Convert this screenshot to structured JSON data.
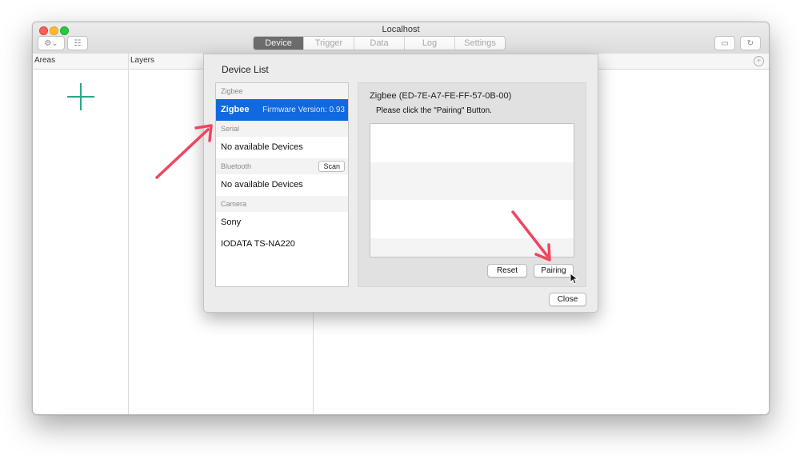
{
  "window": {
    "title": "Localhost"
  },
  "toolbar": {
    "tabs": [
      "Device",
      "Trigger",
      "Data",
      "Log",
      "Settings"
    ],
    "active_tab": "Device",
    "left_icons": [
      "gear-menu-icon",
      "sidebar-toggle-icon"
    ],
    "right_icons": [
      "monitor-icon",
      "refresh-icon"
    ]
  },
  "columns": {
    "areas": "Areas",
    "layers": "Layers"
  },
  "dialog": {
    "title": "Device List",
    "sections": [
      {
        "name": "Zigbee",
        "items": [
          {
            "label": "Zigbee",
            "detail": "Firmware Version: 0.93",
            "selected": true
          }
        ]
      },
      {
        "name": "Serial",
        "items": [
          {
            "label": "No available Devices"
          }
        ]
      },
      {
        "name": "Bluetooth",
        "button": "Scan",
        "items": [
          {
            "label": "No available Devices"
          }
        ]
      },
      {
        "name": "Camera",
        "items": [
          {
            "label": "Sony"
          },
          {
            "label": "IODATA TS-NA220"
          }
        ]
      }
    ],
    "detail_title": "Zigbee (ED-7E-A7-FE-FF-57-0B-00)",
    "detail_message": "Please click the \"Pairing\" Button.",
    "reset_label": "Reset",
    "pairing_label": "Pairing",
    "close_label": "Close"
  },
  "colors": {
    "selection": "#1069e0",
    "annotation_arrow": "#f0455f",
    "plus_accent": "#2aa889"
  }
}
